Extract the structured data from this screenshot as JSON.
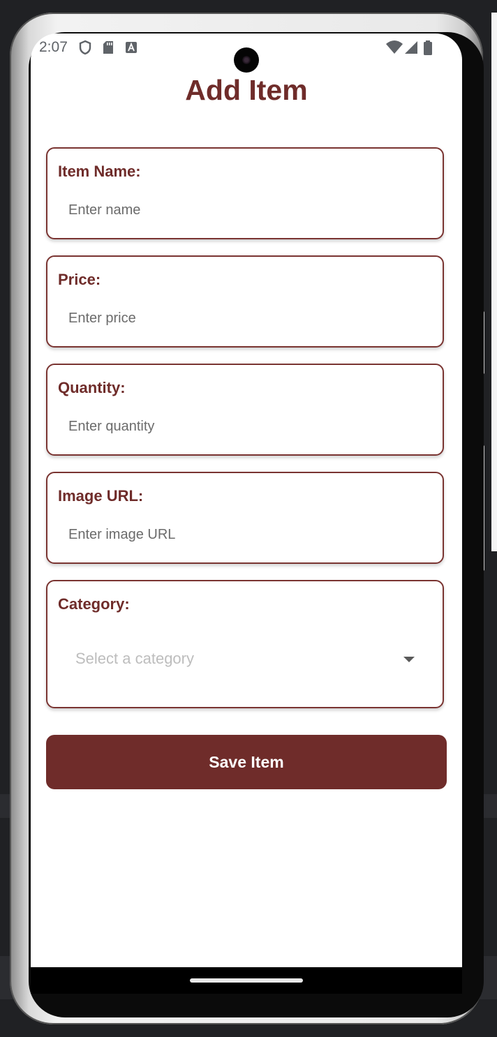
{
  "status_bar": {
    "time": "2:07",
    "icons": [
      "shield-icon",
      "sd-card-icon",
      "keyboard-a-icon",
      "wifi-icon",
      "signal-icon",
      "battery-icon"
    ]
  },
  "page": {
    "title": "Add Item"
  },
  "form": {
    "item_name": {
      "label": "Item Name:",
      "placeholder": "Enter name",
      "value": ""
    },
    "price": {
      "label": "Price:",
      "placeholder": "Enter price",
      "value": ""
    },
    "quantity": {
      "label": "Quantity:",
      "placeholder": "Enter quantity",
      "value": ""
    },
    "image_url": {
      "label": "Image URL:",
      "placeholder": "Enter image URL",
      "value": ""
    },
    "category": {
      "label": "Category:",
      "placeholder": "Select a category"
    }
  },
  "save_label": "Save Item",
  "colors": {
    "accent": "#6f2c2a",
    "card_border": "#7a3431",
    "background": "#ffffff",
    "placeholder": "#6b6b6b",
    "select_placeholder": "#bdbdbd"
  }
}
